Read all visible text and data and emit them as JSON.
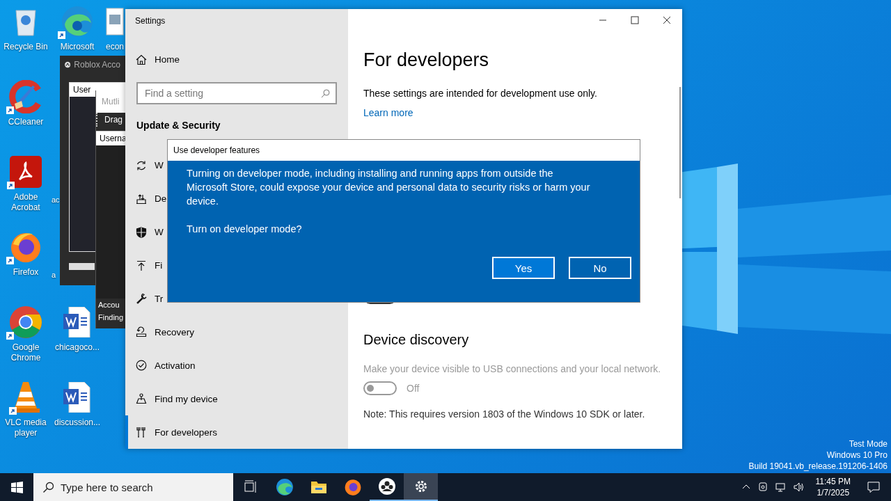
{
  "desktop": {
    "icon_columns": [
      [
        {
          "label": "Recycle Bin",
          "kind": "recycle",
          "shortcut": false
        },
        {
          "label": "CCleaner",
          "kind": "ccleaner",
          "shortcut": true
        },
        {
          "label": "Adobe Acrobat",
          "kind": "pdf",
          "shortcut": true
        },
        {
          "label": "Firefox",
          "kind": "firefox",
          "shortcut": true
        },
        {
          "label": "Google Chrome",
          "kind": "chrome",
          "shortcut": true
        },
        {
          "label": "VLC media player",
          "kind": "vlc",
          "shortcut": true
        }
      ],
      [
        {
          "label": "Microsoft",
          "kind": "edge",
          "shortcut": true
        },
        {
          "label": "ac",
          "kind": "hidden",
          "shortcut": false
        },
        {
          "label": "a",
          "kind": "hidden",
          "shortcut": false
        },
        {
          "label": "chicagoco...",
          "kind": "word",
          "shortcut": false
        },
        {
          "label": "discussion...",
          "kind": "word",
          "shortcut": false
        }
      ],
      [
        {
          "label": "econ",
          "kind": "image",
          "shortcut": false
        }
      ]
    ],
    "system_text": [
      "Test Mode",
      "Windows 10 Pro",
      "Build 19041.vb_release.191206-1406"
    ]
  },
  "background_windows": [
    {
      "title": "Roblox Acco",
      "list_header": "User"
    },
    {
      "title": "Mutli",
      "toolbar": "Drag",
      "list_header": "Userna",
      "status_lines": [
        "Accou",
        "Finding"
      ]
    }
  ],
  "settings": {
    "title": "Settings",
    "home": "Home",
    "search": {
      "placeholder": "Find a setting"
    },
    "section": "Update & Security",
    "sidebar": {
      "items": [
        {
          "label": "W",
          "kind": "sync",
          "selected": false
        },
        {
          "label": "De",
          "kind": "delivery",
          "selected": false
        },
        {
          "label": "W",
          "kind": "shield",
          "selected": false
        },
        {
          "label": "Fi",
          "kind": "backup",
          "selected": false
        },
        {
          "label": "Tr",
          "kind": "wrench",
          "selected": false
        },
        {
          "label": "Recovery",
          "kind": "recovery",
          "selected": false
        },
        {
          "label": "Activation",
          "kind": "activation",
          "selected": false
        },
        {
          "label": "Find my device",
          "kind": "find",
          "selected": false
        },
        {
          "label": "For developers",
          "kind": "developers",
          "selected": true
        }
      ]
    },
    "page": {
      "title": "For developers",
      "intro": "These settings are intended for development use only.",
      "link": "Learn more",
      "developer_mode_toggle": {
        "on": false
      },
      "section": {
        "title": "Device discovery",
        "description": "Make your device visible to USB connections and your local network.",
        "disabled": true,
        "toggle": {
          "on": false,
          "label": "Off"
        },
        "note": "Note: This requires version 1803 of the Windows 10 SDK or later."
      }
    }
  },
  "dialog": {
    "title": "Use developer features",
    "paragraphs": [
      "Turning on developer mode, including installing and running apps from outside the Microsoft Store, could expose your device and personal data to security risks or harm your device.",
      "Turn on developer mode?"
    ],
    "buttons": [
      {
        "label": "Yes",
        "selected": true
      },
      {
        "label": "No",
        "selected": false
      }
    ]
  },
  "taskbar": {
    "search": {
      "placeholder": "Type here to search"
    },
    "apps": [
      {
        "kind": "taskview",
        "running": false,
        "active": false
      },
      {
        "kind": "edge",
        "running": false,
        "active": false
      },
      {
        "kind": "folder",
        "running": false,
        "active": false
      },
      {
        "kind": "firefox",
        "running": false,
        "active": false
      },
      {
        "kind": "people",
        "running": true,
        "active": false
      },
      {
        "kind": "settings",
        "running": true,
        "active": true
      }
    ],
    "time": "11:45 PM",
    "date": "1/7/2025"
  }
}
